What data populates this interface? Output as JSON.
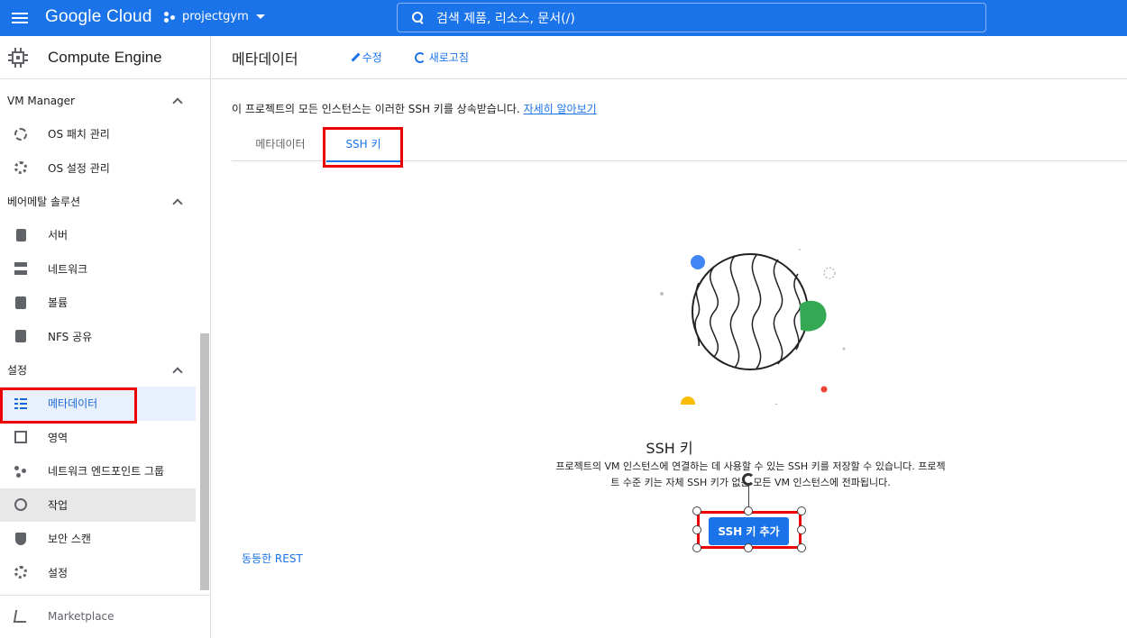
{
  "topbar": {
    "logo": "Google Cloud",
    "project": "projectgym",
    "search_placeholder": "검색  제품, 리소스, 문서(/)"
  },
  "sidebar": {
    "product_title": "Compute Engine",
    "sections": {
      "vm_manager": "VM Manager",
      "baremetal": "베어메탈 솔루션",
      "settings": "설정"
    },
    "items": {
      "os_patch": "OS 패치 관리",
      "os_config": "OS 설정 관리",
      "servers": "서버",
      "network": "네트워크",
      "volumes": "볼륨",
      "nfs": "NFS 공유",
      "metadata": "메타데이터",
      "zones": "영역",
      "network_endpoint_groups": "네트워크 엔드포인트 그룹",
      "operations": "작업",
      "security_scans": "보안 스캔",
      "settings": "설정",
      "marketplace": "Marketplace"
    }
  },
  "main": {
    "title": "메타데이터",
    "edit_label": "수정",
    "refresh_label": "새로고침",
    "notice_text": "이 프로젝트의 모든 인스턴스는 이러한 SSH 키를 상속받습니다.",
    "notice_link": "자세히 알아보기",
    "tabs": [
      "메타데이터",
      "SSH 키"
    ],
    "empty_state": {
      "title": "SSH 키",
      "description": "프로젝트의 VM 인스턴스에 연결하는 데 사용할 수 있는 SSH 키를 저장할 수 있습니다. 프로젝트 수준 키는 자체 SSH 키가 없는 모든 VM 인스턴스에 전파됩니다.",
      "add_button": "SSH 키 추가"
    },
    "rest_link": "동등한 REST"
  },
  "colors": {
    "brand_blue": "#1a73e8",
    "highlight_red": "#e00000",
    "illus_blue": "#4285f4",
    "illus_green": "#34a853",
    "illus_yellow": "#fbbc04",
    "illus_red": "#ea4335"
  }
}
